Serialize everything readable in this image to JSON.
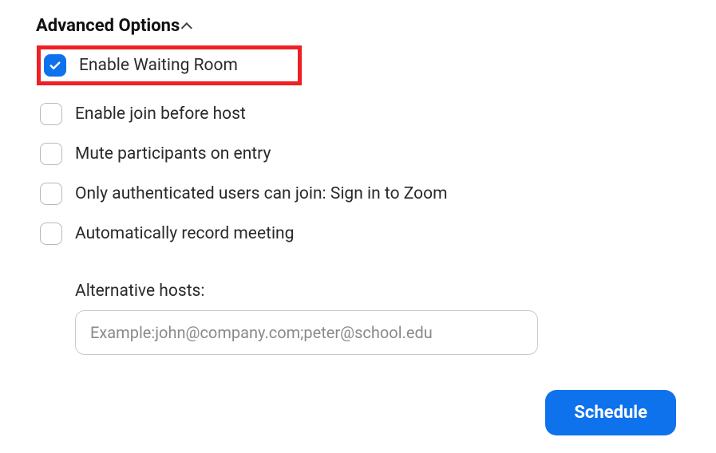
{
  "section": {
    "title": "Advanced Options"
  },
  "options": {
    "waitingRoom": {
      "label": "Enable Waiting Room",
      "checked": true,
      "highlighted": true
    },
    "joinBeforeHost": {
      "label": "Enable join before host",
      "checked": false
    },
    "muteOnEntry": {
      "label": "Mute participants on entry",
      "checked": false
    },
    "authOnly": {
      "label": "Only authenticated users can join: Sign in to Zoom",
      "checked": false
    },
    "autoRecord": {
      "label": "Automatically record meeting",
      "checked": false
    }
  },
  "altHosts": {
    "label": "Alternative hosts:",
    "placeholder": "Example:john@company.com;peter@school.edu",
    "value": ""
  },
  "footer": {
    "scheduleLabel": "Schedule"
  }
}
